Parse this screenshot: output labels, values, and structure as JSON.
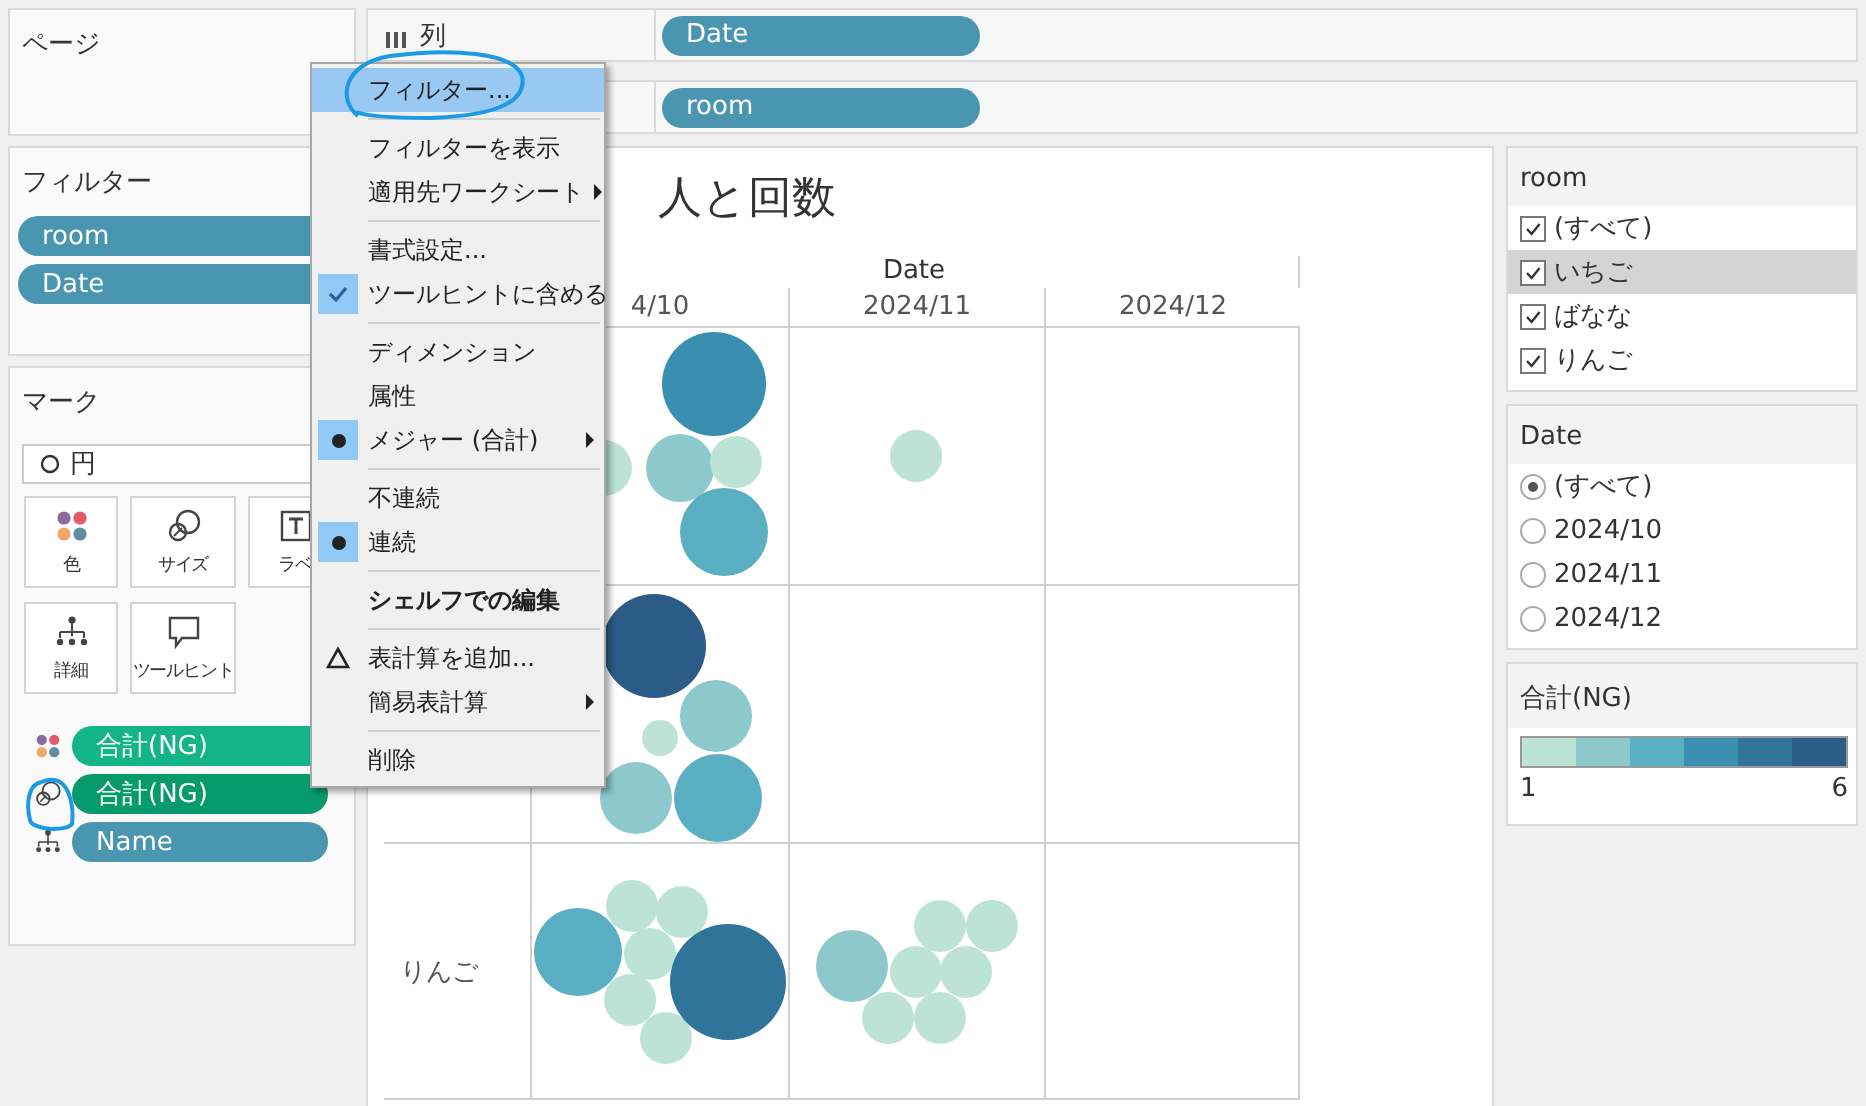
{
  "pages_card": {
    "title": "ページ"
  },
  "filters_card": {
    "title": "フィルター",
    "pills": [
      "room",
      "Date"
    ]
  },
  "marks_card": {
    "title": "マーク",
    "mark_type": "円",
    "buttons": [
      {
        "label": "色",
        "kind": "color"
      },
      {
        "label": "サイズ",
        "kind": "size"
      },
      {
        "label": "ラベ",
        "kind": "label"
      },
      {
        "label": "詳細",
        "kind": "detail"
      },
      {
        "label": "ツールヒント",
        "kind": "tooltip"
      }
    ],
    "fields": [
      {
        "label": "合計(NG)",
        "kind": "color"
      },
      {
        "label": "合計(NG)",
        "kind": "size"
      },
      {
        "label": "Name",
        "kind": "detail"
      }
    ]
  },
  "columns_shelf": {
    "label": "列",
    "pills": [
      "Date"
    ]
  },
  "rows_shelf": {
    "pills": [
      "room"
    ]
  },
  "view": {
    "title": "人と回数",
    "column_header": "Date",
    "columns": [
      "4/10",
      "2024/11",
      "2024/12"
    ],
    "row_labels": [
      "りんご"
    ]
  },
  "room_filter": {
    "title": "room",
    "items": [
      {
        "label": "(すべて)",
        "checked": true,
        "highlighted": false
      },
      {
        "label": "いちご",
        "checked": true,
        "highlighted": true
      },
      {
        "label": "ばなな",
        "checked": true,
        "highlighted": false
      },
      {
        "label": "りんご",
        "checked": true,
        "highlighted": false
      }
    ]
  },
  "date_filter": {
    "title": "Date",
    "items": [
      {
        "label": "(すべて)",
        "selected": true
      },
      {
        "label": "2024/10",
        "selected": false
      },
      {
        "label": "2024/11",
        "selected": false
      },
      {
        "label": "2024/12",
        "selected": false
      }
    ]
  },
  "legend": {
    "title": "合計(NG)",
    "min": "1",
    "max": "6"
  },
  "context_menu": {
    "items": [
      {
        "kind": "action",
        "label": "フィルター...",
        "highlighted": true,
        "submenu": false,
        "bold": false
      },
      {
        "kind": "separator"
      },
      {
        "kind": "action",
        "label": "フィルターを表示",
        "highlighted": false,
        "submenu": false,
        "bold": false
      },
      {
        "kind": "action",
        "label": "適用先ワークシート",
        "highlighted": false,
        "submenu": true,
        "bold": false
      },
      {
        "kind": "separator"
      },
      {
        "kind": "action",
        "label": "書式設定...",
        "highlighted": false,
        "submenu": false,
        "bold": false
      },
      {
        "kind": "check",
        "label": "ツールヒントに含める",
        "checked": true,
        "highlighted": false,
        "submenu": false,
        "bold": false
      },
      {
        "kind": "separator"
      },
      {
        "kind": "radio",
        "label": "ディメンション",
        "checked": false,
        "highlighted": false,
        "submenu": false,
        "bold": false
      },
      {
        "kind": "radio",
        "label": "属性",
        "checked": false,
        "highlighted": false,
        "submenu": false,
        "bold": false
      },
      {
        "kind": "radio",
        "label": "メジャー (合計)",
        "checked": true,
        "highlighted": false,
        "submenu": true,
        "bold": false
      },
      {
        "kind": "separator"
      },
      {
        "kind": "radio",
        "label": "不連続",
        "checked": false,
        "highlighted": false,
        "submenu": false,
        "bold": false
      },
      {
        "kind": "radio",
        "label": "連続",
        "checked": true,
        "highlighted": false,
        "submenu": false,
        "bold": false
      },
      {
        "kind": "separator"
      },
      {
        "kind": "action",
        "label": "シェルフでの編集",
        "highlighted": false,
        "submenu": false,
        "bold": true
      },
      {
        "kind": "separator"
      },
      {
        "kind": "calc",
        "label": "表計算を追加...",
        "highlighted": false,
        "submenu": false,
        "bold": false
      },
      {
        "kind": "action",
        "label": "簡易表計算",
        "highlighted": false,
        "submenu": true,
        "bold": false
      },
      {
        "kind": "separator"
      },
      {
        "kind": "action",
        "label": "削除",
        "highlighted": false,
        "submenu": false,
        "bold": false
      }
    ]
  }
}
